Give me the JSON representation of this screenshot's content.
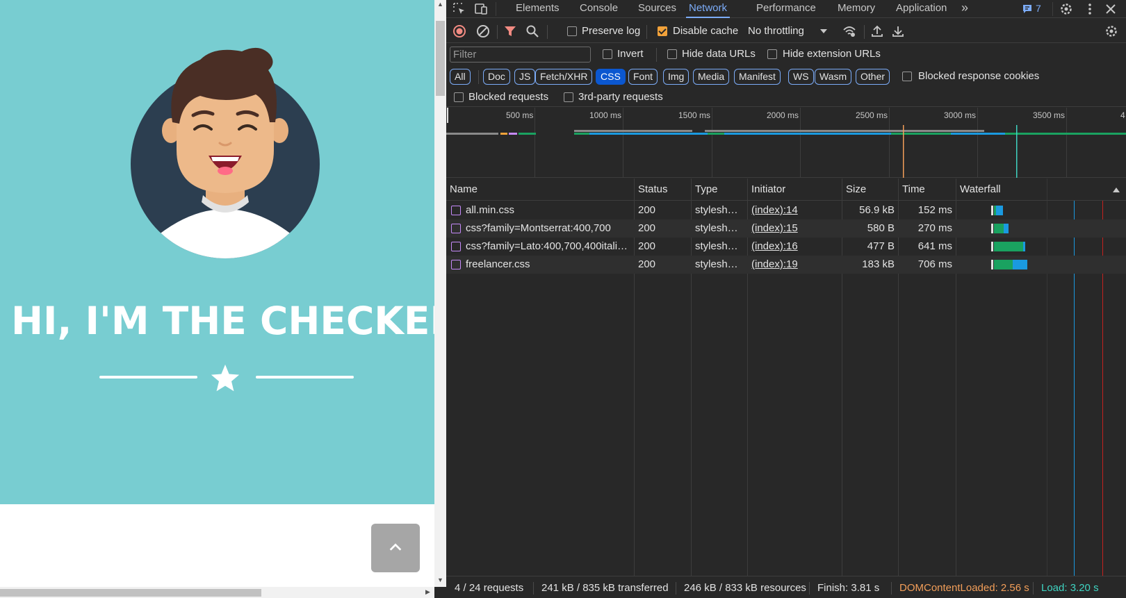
{
  "page": {
    "hero_title": "HI, I'M THE CHECKER!",
    "hero_bg": "#78cdd1",
    "scroll_top_icon": "chevron-up-icon"
  },
  "devtools": {
    "tabs": [
      {
        "label": "Elements"
      },
      {
        "label": "Console"
      },
      {
        "label": "Sources"
      },
      {
        "label": "Network"
      },
      {
        "label": "Performance"
      },
      {
        "label": "Memory"
      },
      {
        "label": "Application"
      }
    ],
    "active_tab": "Network",
    "more_tabs_icon": "»",
    "issues_count": "7",
    "toolbar": {
      "preserve_log": "Preserve log",
      "disable_cache": "Disable cache",
      "throttling": "No throttling"
    },
    "filter": {
      "placeholder": "Filter",
      "invert": "Invert",
      "hide_data_urls": "Hide data URLs",
      "hide_extension_urls": "Hide extension URLs"
    },
    "type_filters": [
      "All",
      "Doc",
      "JS",
      "Fetch/XHR",
      "CSS",
      "Font",
      "Img",
      "Media",
      "Manifest",
      "WS",
      "Wasm",
      "Other"
    ],
    "active_type_filter": "CSS",
    "blocked_response_cookies": "Blocked response cookies",
    "blocked_requests": "Blocked requests",
    "third_party_requests": "3rd-party requests",
    "overview_ticks": [
      "500 ms",
      "1000 ms",
      "1500 ms",
      "2000 ms",
      "2500 ms",
      "3000 ms",
      "3500 ms",
      "4"
    ],
    "columns": {
      "name": "Name",
      "status": "Status",
      "type": "Type",
      "initiator": "Initiator",
      "size": "Size",
      "time": "Time",
      "waterfall": "Waterfall"
    },
    "requests": [
      {
        "name": "all.min.css",
        "status": "200",
        "type": "stylesh…",
        "initiator": "(index):14",
        "size": "56.9 kB",
        "time": "152 ms"
      },
      {
        "name": "css?family=Montserrat:400,700",
        "status": "200",
        "type": "stylesh…",
        "initiator": "(index):15",
        "size": "580 B",
        "time": "270 ms"
      },
      {
        "name": "css?family=Lato:400,700,400itali…",
        "status": "200",
        "type": "stylesh…",
        "initiator": "(index):16",
        "size": "477 B",
        "time": "641 ms"
      },
      {
        "name": "freelancer.css",
        "status": "200",
        "type": "stylesh…",
        "initiator": "(index):19",
        "size": "183 kB",
        "time": "706 ms"
      }
    ],
    "status_bar": {
      "requests": "4 / 24 requests",
      "transferred": "241 kB / 835 kB transferred",
      "resources": "246 kB / 833 kB resources",
      "finish": "Finish: 3.81 s",
      "dom_content_loaded": "DOMContentLoaded: 2.56 s",
      "load": "Load: 3.20 s"
    },
    "colors": {
      "accent": "#7cacf8",
      "dcl": "#f29e59",
      "load": "#3fd4c2",
      "waiting": "#1aa260",
      "download": "#1a9ae0"
    }
  }
}
